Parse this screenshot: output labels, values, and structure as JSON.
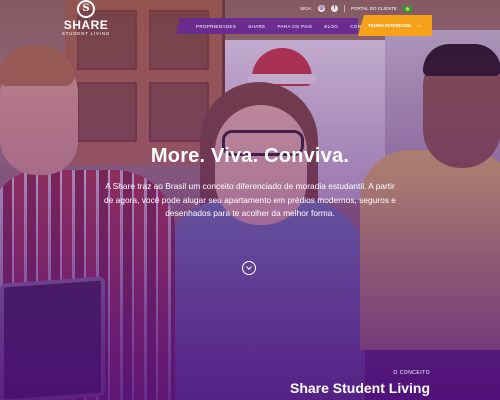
{
  "brand": {
    "logo_mark": "S",
    "name": "SHARE",
    "tagline": "STUDENT LIVING"
  },
  "utility_bar": {
    "social_label": "SIGA:",
    "social_icons": [
      "instagram-icon",
      "facebook-icon"
    ],
    "client_portal": "PORTAL DO CLIENTE",
    "language_flag": "brazil-flag-icon"
  },
  "nav": {
    "items": [
      {
        "label": "PROPRIEDADES"
      },
      {
        "label": "SHARE"
      },
      {
        "label": "PARA OS PAIS"
      },
      {
        "label": "BLOG"
      },
      {
        "label": "CONTATO"
      }
    ],
    "cta_label": "TENHO INTERESSE",
    "cta_arrow": "→"
  },
  "hero": {
    "headline": "More. Viva. Conviva.",
    "intro": "A Share traz ao Brasil um conceito diferenciado de moradia estudantil. A partir de agora, você pode alugar seu apartamento em prédios modernos, seguros e desenhados para te acolher da melhor forma."
  },
  "concept": {
    "eyebrow": "O CONCEITO",
    "title": "Share Student Living"
  },
  "colors": {
    "nav_purple": "#6a2d8f",
    "cta_orange": "#f5a21a",
    "overlay_purple": "#5a1f85"
  }
}
